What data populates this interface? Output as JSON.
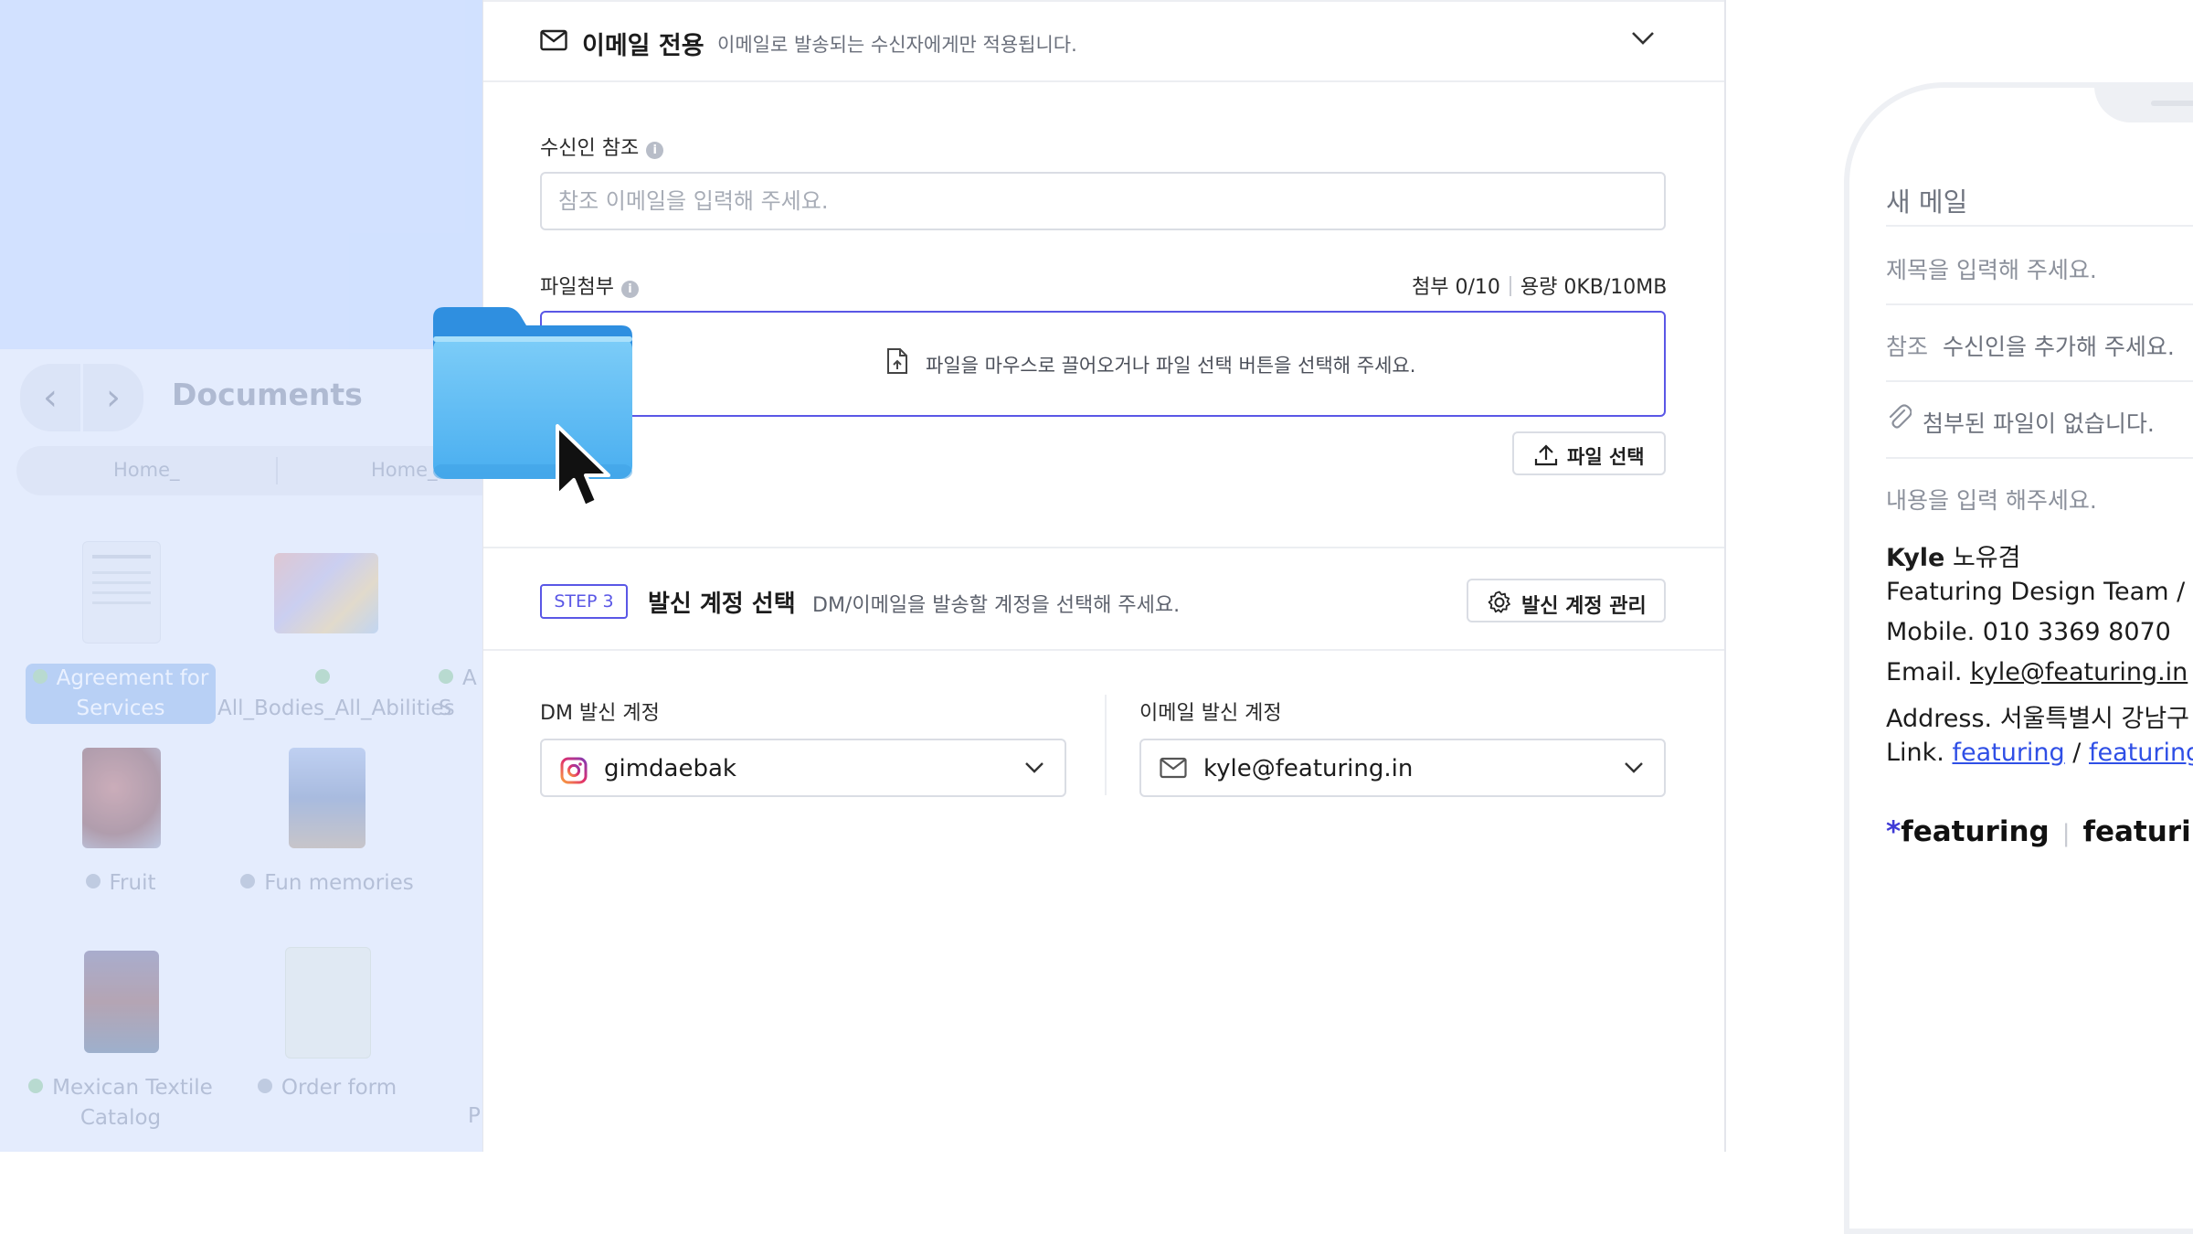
{
  "finder": {
    "title": "Documents",
    "tabs": [
      "Home_",
      "Home_"
    ],
    "nav": {
      "back": "‹",
      "forward": "›"
    },
    "files": [
      {
        "label": "Agreement for Services",
        "tag": "green",
        "selected": true
      },
      {
        "label": "All_Bodies_All_Abilities",
        "tag": "green"
      },
      {
        "label": "A S",
        "tag": "green"
      },
      {
        "label": "Fruit",
        "tag": "gray"
      },
      {
        "label": "Fun memories",
        "tag": "gray"
      },
      {
        "label": "Mexican Textile Catalog",
        "tag": "green"
      },
      {
        "label": "Order form",
        "tag": "gray"
      },
      {
        "label": "P",
        "tag": "none"
      }
    ]
  },
  "email_section": {
    "title": "이메일 전용",
    "description": "이메일로 발송되는 수신자에게만 적용됩니다.",
    "cc_label": "수신인 참조",
    "cc_placeholder": "참조 이메일을 입력해 주세요.",
    "attach_label": "파일첨부",
    "attach_count": "첨부 0/10",
    "attach_size": "용량 0KB/10MB",
    "dropzone_text": "파일을 마우스로 끌어오거나 파일 선택 버튼을 선택해 주세요.",
    "select_file_button": "파일 선택"
  },
  "step3": {
    "badge": "STEP 3",
    "title": "발신 계정 선택",
    "description": "DM/이메일을 발송할 계정을 선택해 주세요.",
    "manage_button": "발신 계정 관리",
    "dm_label": "DM 발신 계정",
    "dm_account": "gimdaebak",
    "email_label": "이메일 발신 계정",
    "email_account": "kyle@featuring.in"
  },
  "preview": {
    "header": "새 메일",
    "subject_placeholder": "제목을 입력해 주세요.",
    "cc_prefix": "참조",
    "cc_placeholder": "수신인을 추가해 주세요.",
    "attach_empty": "첨부된 파일이 없습니다.",
    "body_placeholder": "내용을 입력 해주세요.",
    "signature": {
      "name_bold": "Kyle",
      "name_kr": "노유겸",
      "team": "Featuring Design Team / Pr",
      "mobile": "Mobile. 010 3369 8070",
      "email_prefix": "Email.",
      "email": "kyle@featuring.in",
      "address": "Address. 서울특별시 강남구 E",
      "link_prefix": "Link.",
      "link1": "featuring",
      "link_sep": "/",
      "link2": "featuring e"
    },
    "logo1": "featuring",
    "logo1_mark": "*",
    "logo_sep": "|",
    "logo2": "featuring"
  },
  "colors": {
    "accent": "#5a57e6",
    "link": "#2f4fe6",
    "folder": "#5cb9f2",
    "finder_bg": "#d5e3ff"
  }
}
